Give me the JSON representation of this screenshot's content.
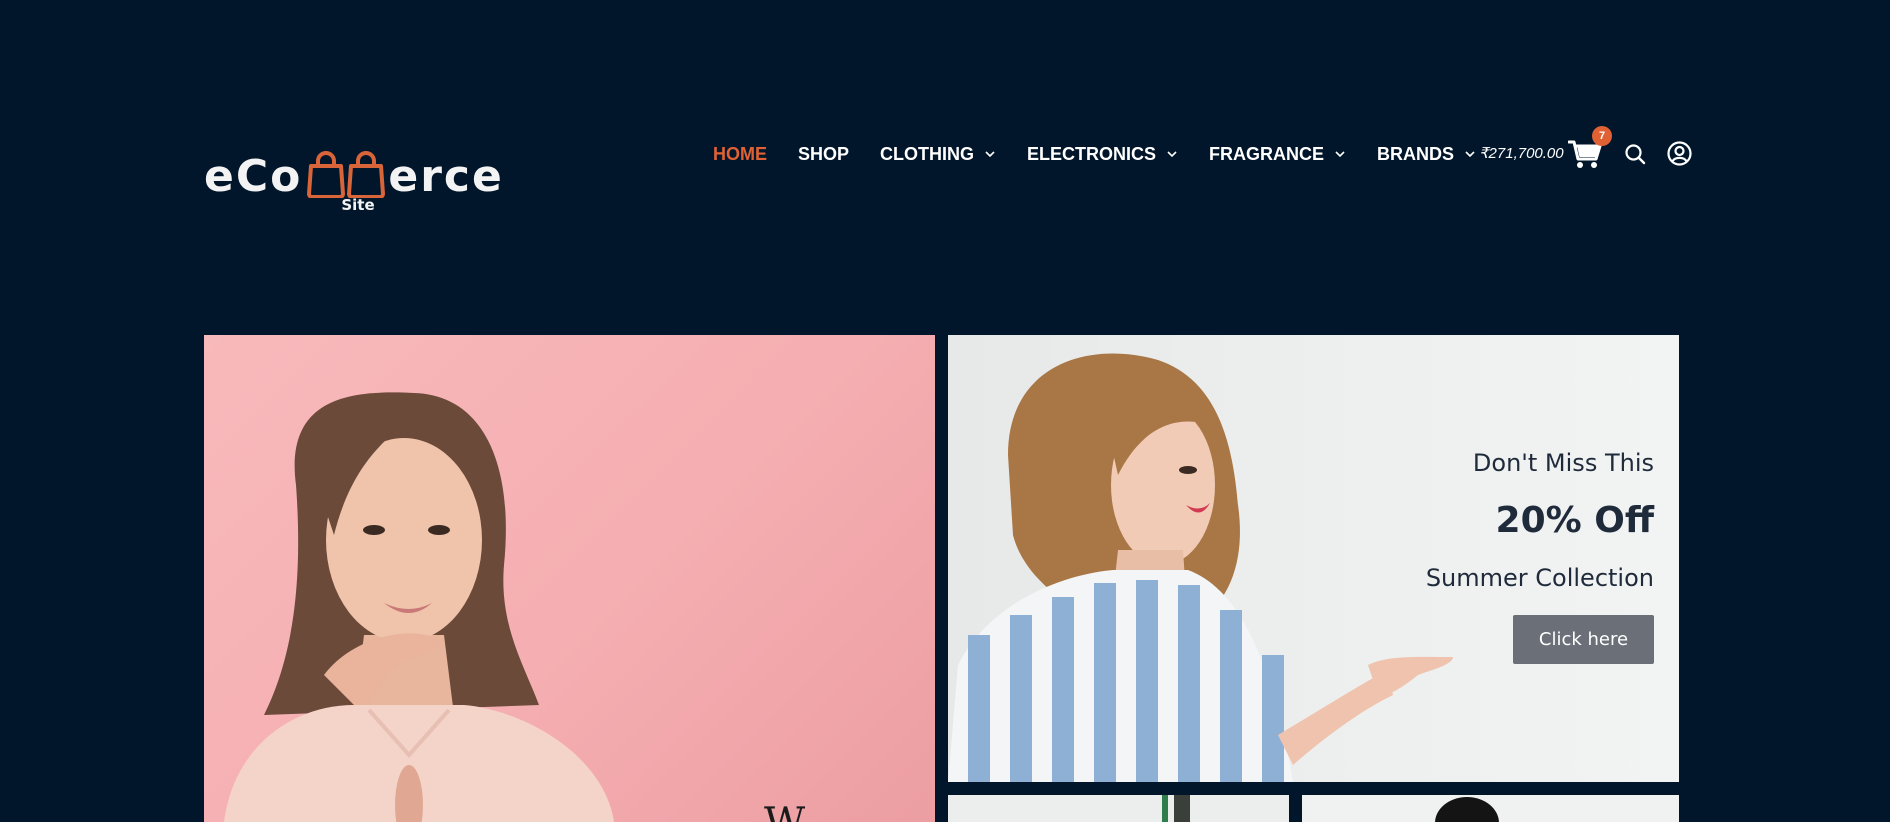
{
  "header": {
    "logo": {
      "text_left": "eCo",
      "text_right": "erce",
      "subtitle": "Site",
      "accent_color": "#d8643a"
    },
    "nav": [
      {
        "label": "HOME",
        "active": true,
        "has_dropdown": false
      },
      {
        "label": "SHOP",
        "active": false,
        "has_dropdown": false
      },
      {
        "label": "CLOTHING",
        "active": false,
        "has_dropdown": true
      },
      {
        "label": "ELECTRONICS",
        "active": false,
        "has_dropdown": true
      },
      {
        "label": "FRAGRANCE",
        "active": false,
        "has_dropdown": true
      },
      {
        "label": "BRANDS",
        "active": false,
        "has_dropdown": true
      }
    ],
    "cart": {
      "total": "₹271,700.00",
      "count": "7",
      "icon": "cart-icon"
    },
    "search_icon": "search-icon",
    "account_icon": "account-icon"
  },
  "hero": {
    "right_banner": {
      "kicker": "Don't Miss This",
      "headline": "20% Off",
      "subtitle": "Summer Collection",
      "button_label": "Click here"
    },
    "left_banner": {
      "caption_partial": "W"
    }
  },
  "colors": {
    "background": "#01162b",
    "accent": "#e06234",
    "button": "#6b7078",
    "promo_text": "#1f2a3a"
  }
}
